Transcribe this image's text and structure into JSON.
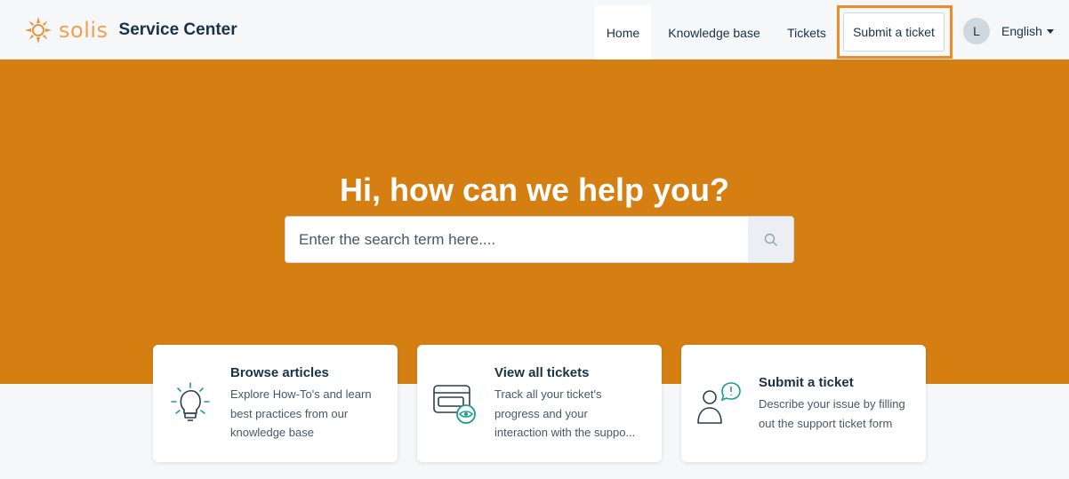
{
  "brand": {
    "logo_word": "solis",
    "title": "Service Center",
    "logo_icon": "sun-logo-icon"
  },
  "nav": {
    "home": "Home",
    "knowledge_base": "Knowledge base",
    "tickets": "Tickets",
    "submit_ticket": "Submit a ticket"
  },
  "user": {
    "avatar_initial": "L",
    "language": "English"
  },
  "hero": {
    "title": "Hi, how can we help you?",
    "search_placeholder": "Enter the search term here....",
    "search_icon": "search-icon"
  },
  "cards": [
    {
      "title": "Browse articles",
      "line1": "Explore How-To's and learn",
      "line2": "best practices from our",
      "line3": "knowledge base",
      "icon": "lightbulb-icon"
    },
    {
      "title": "View all tickets",
      "line1": "Track all your ticket's",
      "line2": "progress and your",
      "line3": "interaction with the suppo...",
      "icon": "tickets-view-icon"
    },
    {
      "title": "Submit a ticket",
      "line1": "Describe your issue by filling",
      "line2": "out the support ticket form",
      "icon": "user-alert-icon"
    }
  ],
  "colors": {
    "hero_bg": "#d57e12",
    "accent_teal": "#1b9e8f",
    "highlight": "#f08a28",
    "text_dark": "#183247"
  }
}
